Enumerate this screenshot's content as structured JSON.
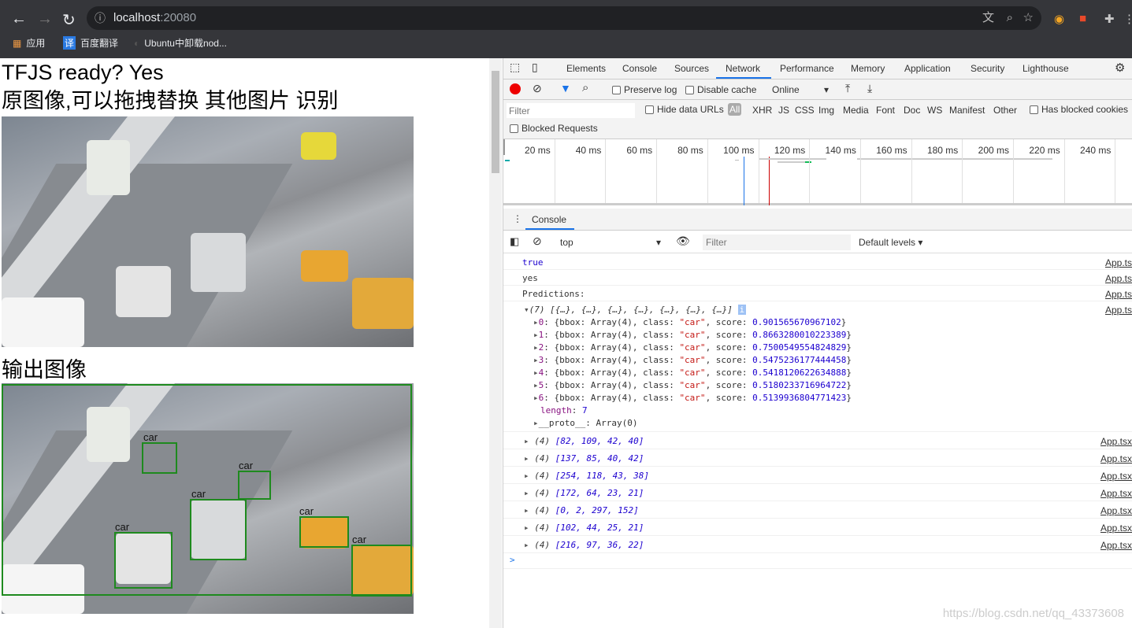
{
  "browser": {
    "url_host": "localhost",
    "url_port": ":20080",
    "bookmarks": [
      "应用",
      "百度翻译",
      "Ubuntu中卸载nod..."
    ]
  },
  "page": {
    "status": "TFJS ready? Yes",
    "original_heading": "原图像,可以拖拽替换 其他图片 识别",
    "output_heading": "输出图像",
    "box_label": "car"
  },
  "devtools": {
    "tabs": [
      "Elements",
      "Console",
      "Sources",
      "Network",
      "Performance",
      "Memory",
      "Application",
      "Security",
      "Lighthouse"
    ],
    "active_tab": "Network",
    "network": {
      "preserve_log": "Preserve log",
      "disable_cache": "Disable cache",
      "throttle": "Online",
      "filter_placeholder": "Filter",
      "hide_data_urls": "Hide data URLs",
      "types": [
        "All",
        "XHR",
        "JS",
        "CSS",
        "Img",
        "Media",
        "Font",
        "Doc",
        "WS",
        "Manifest",
        "Other"
      ],
      "has_blocked_cookies": "Has blocked cookies",
      "blocked_requests": "Blocked Requests",
      "ticks": [
        "20 ms",
        "40 ms",
        "60 ms",
        "80 ms",
        "100 ms",
        "120 ms",
        "140 ms",
        "160 ms",
        "180 ms",
        "200 ms",
        "220 ms",
        "240 ms"
      ]
    },
    "console": {
      "tab": "Console",
      "context": "top",
      "filter_placeholder": "Filter",
      "levels": "Default levels ▾",
      "lines": [
        {
          "text": "true",
          "src": "App.ts"
        },
        {
          "text": "yes",
          "src": "App.ts"
        },
        {
          "text": "Predictions:",
          "src": "App.ts"
        }
      ],
      "array_summary": "(7) [{…}, {…}, {…}, {…}, {…}, {…}, {…}]",
      "array_src": "App.ts",
      "predictions": [
        {
          "i": "0",
          "class": "\"car\"",
          "score": "0.901565670967102"
        },
        {
          "i": "1",
          "class": "\"car\"",
          "score": "0.8663280010223389"
        },
        {
          "i": "2",
          "class": "\"car\"",
          "score": "0.7500549554824829"
        },
        {
          "i": "3",
          "class": "\"car\"",
          "score": "0.5475236177444458"
        },
        {
          "i": "4",
          "class": "\"car\"",
          "score": "0.5418120622634888"
        },
        {
          "i": "5",
          "class": "\"car\"",
          "score": "0.5180233716964722"
        },
        {
          "i": "6",
          "class": "\"car\"",
          "score": "0.5139936804771423"
        }
      ],
      "length_label": "length",
      "length": "7",
      "proto": "__proto__: Array(0)",
      "bboxes": [
        {
          "text": "[82, 109, 42, 40]"
        },
        {
          "text": "[137, 85, 40, 42]"
        },
        {
          "text": "[254, 118, 43, 38]"
        },
        {
          "text": "[172, 64, 23, 21]"
        },
        {
          "text": "[0, 2, 297, 152]"
        },
        {
          "text": "[102, 44, 25, 21]"
        },
        {
          "text": "[216, 97, 36, 22]"
        }
      ],
      "bbox_prefix": "(4)",
      "bbox_src": "App.tsx",
      "prompt": ">"
    }
  },
  "watermark": "https://blog.csdn.net/qq_43373608"
}
